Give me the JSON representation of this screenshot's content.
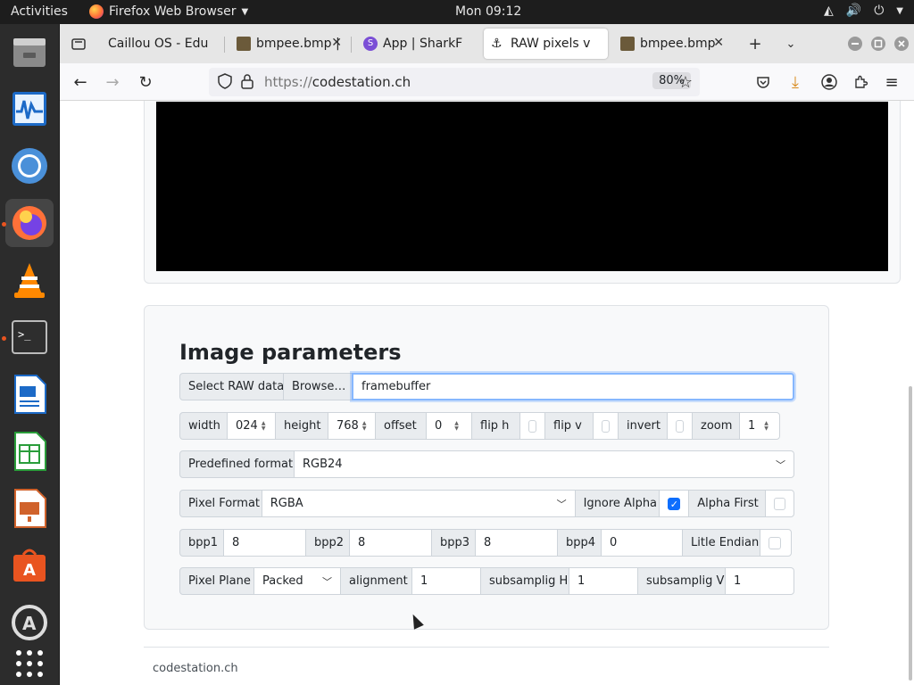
{
  "topbar": {
    "activities": "Activities",
    "app_name": "Firefox Web Browser",
    "clock": "Mon 09:12"
  },
  "dock": {
    "items": [
      "file-manager-icon",
      "system-monitor-icon",
      "chromium-icon",
      "firefox-icon",
      "vlc-icon",
      "terminal-icon",
      "writer-icon",
      "calc-icon",
      "impress-icon",
      "software-center-icon",
      "updater-icon",
      "apps-grid-icon"
    ]
  },
  "browser": {
    "tabs": [
      {
        "title": "Caillou OS - Edu"
      },
      {
        "title": "bmpee.bmp | "
      },
      {
        "title": "App | SharkF"
      },
      {
        "title": "RAW pixels v"
      },
      {
        "title": "bmpee.bmp"
      }
    ],
    "url_proto": "https://",
    "url_host": "codestation.ch",
    "zoom": "80%"
  },
  "params": {
    "title": "Image parameters",
    "select_raw_label": "Select RAW data",
    "browse_label": "Browse…",
    "file_name": "framebuffer",
    "width_label": "width",
    "width_value": "024",
    "height_label": "height",
    "height_value": "768",
    "offset_label": "offset",
    "offset_value": "0",
    "fliph_label": "flip h",
    "flipv_label": "flip v",
    "invert_label": "invert",
    "zoom_label": "zoom",
    "zoom_value": "1",
    "predefined_label": "Predefined format",
    "predefined_value": "RGB24",
    "pixel_format_label": "Pixel Format",
    "pixel_format_value": "RGBA",
    "ignore_alpha_label": "Ignore Alpha",
    "alpha_first_label": "Alpha First",
    "bpp1_label": "bpp1",
    "bpp1_value": "8",
    "bpp2_label": "bpp2",
    "bpp2_value": "8",
    "bpp3_label": "bpp3",
    "bpp3_value": "8",
    "bpp4_label": "bpp4",
    "bpp4_value": "0",
    "little_endian_label": "Litle Endian",
    "pixel_plane_label": "Pixel Plane",
    "pixel_plane_value": "Packed",
    "alignment_label": "alignment",
    "alignment_value": "1",
    "subsamp_h_label": "subsamplig H",
    "subsamp_h_value": "1",
    "subsamp_v_label": "subsamplig V",
    "subsamp_v_value": "1"
  },
  "footer": {
    "text": "codestation.ch"
  }
}
